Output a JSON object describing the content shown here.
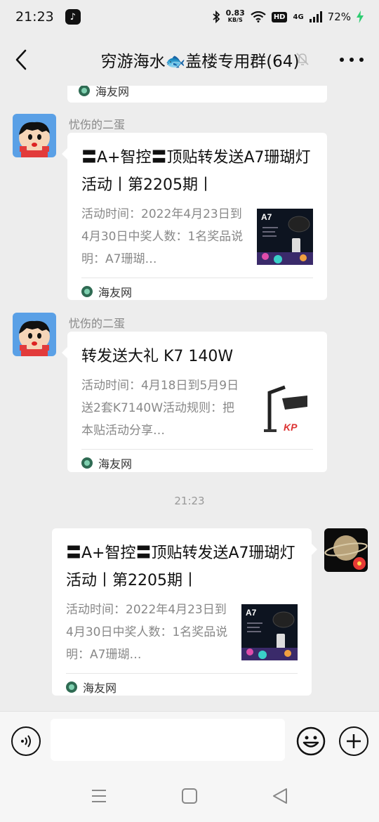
{
  "status": {
    "time": "21:23",
    "net_speed_value": "0.83",
    "net_speed_unit": "KB/S",
    "hd": "HD",
    "network": "4G",
    "battery": "72%"
  },
  "header": {
    "title": "穷游海水🐟盖楼专用群(64)"
  },
  "chat": {
    "partial_card_source": "海友网",
    "messages": [
      {
        "sender": "忧伤的二蛋",
        "title": "〓A+智控〓顶贴转发送A7珊瑚灯活动丨第2205期丨",
        "desc": "活动时间：2022年4月23日到4月30日中奖人数：1名奖品说明：A7珊瑚…",
        "source": "海友网",
        "thumb_label": "A7"
      },
      {
        "sender": "忧伤的二蛋",
        "title": "转发送大礼 K7 140W",
        "desc": "活动时间：4月18日到5月9日送2套K7140W活动规则：把本贴活动分享…",
        "source": "海友网",
        "thumb_label": "KP"
      },
      {
        "title": "〓A+智控〓顶贴转发送A7珊瑚灯活动丨第2205期丨",
        "desc": "活动时间：2022年4月23日到4月30日中奖人数：1名奖品说明：A7珊瑚…",
        "source": "海友网",
        "thumb_label": "A7"
      }
    ],
    "timestamp": "21:23"
  },
  "input": {
    "placeholder": ""
  },
  "colors": {
    "background": "#ededed",
    "card": "#ffffff",
    "muted_text": "#888888"
  }
}
